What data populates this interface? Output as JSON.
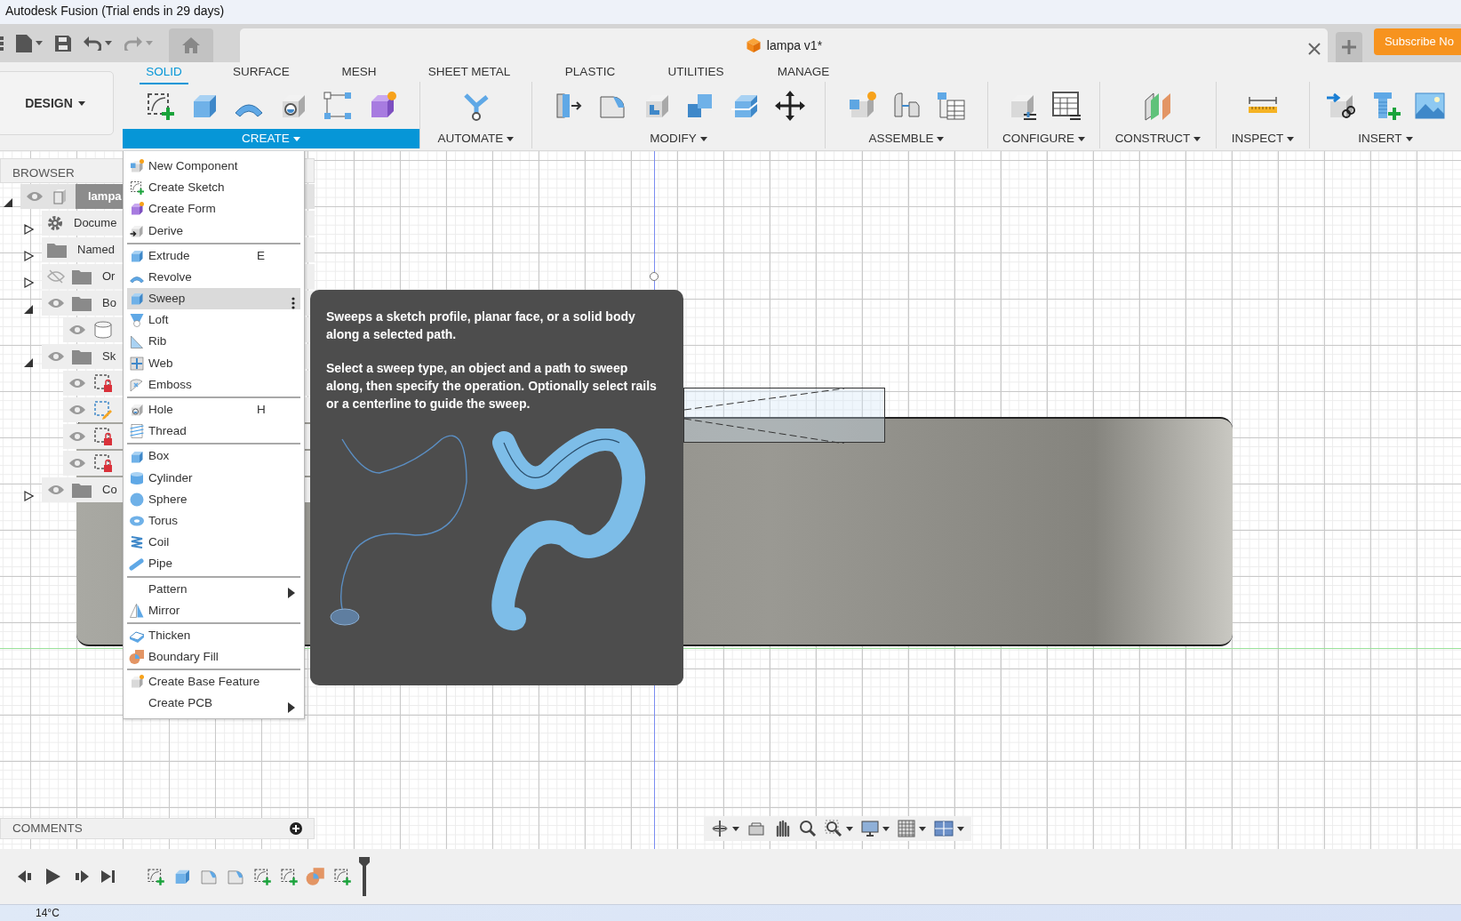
{
  "window": {
    "title": "Autodesk Fusion (Trial ends in 29 days)"
  },
  "document_tab": {
    "title": "lampa v1*"
  },
  "subscribe_button": {
    "label": "Subscribe No"
  },
  "workspace_menu": {
    "label": "DESIGN"
  },
  "ribbon_tabs": [
    {
      "label": "SOLID",
      "selected": true
    },
    {
      "label": "SURFACE",
      "selected": false
    },
    {
      "label": "MESH",
      "selected": false
    },
    {
      "label": "SHEET METAL",
      "selected": false
    },
    {
      "label": "PLASTIC",
      "selected": false
    },
    {
      "label": "UTILITIES",
      "selected": false
    },
    {
      "label": "MANAGE",
      "selected": false
    }
  ],
  "tool_groups": [
    {
      "label": "CREATE",
      "selected": true
    },
    {
      "label": "AUTOMATE",
      "selected": false
    },
    {
      "label": "MODIFY",
      "selected": false
    },
    {
      "label": "ASSEMBLE",
      "selected": false
    },
    {
      "label": "CONFIGURE",
      "selected": false
    },
    {
      "label": "CONSTRUCT",
      "selected": false
    },
    {
      "label": "INSPECT",
      "selected": false
    },
    {
      "label": "INSERT",
      "selected": false
    }
  ],
  "browser": {
    "title": "BROWSER",
    "items": [
      {
        "label": "lampa",
        "kind": "component",
        "visible": true,
        "expanded": true,
        "selected": true,
        "children": [
          {
            "label": "Docume",
            "kind": "settings",
            "expanded": false,
            "selected": false
          },
          {
            "label": "Named",
            "kind": "folder",
            "expanded": false,
            "selected": false
          },
          {
            "label": "Or",
            "kind": "folder",
            "visible": false,
            "expanded": false,
            "selected": false
          },
          {
            "label": "Bo",
            "kind": "folder",
            "visible": true,
            "expanded": true,
            "selected": false,
            "children": [
              {
                "kind": "body",
                "visible": true,
                "selected": false
              }
            ]
          },
          {
            "label": "Sk",
            "kind": "folder",
            "visible": true,
            "expanded": true,
            "selected": false,
            "children": [
              {
                "kind": "sketch",
                "visible": true,
                "locked": true,
                "selected": false
              },
              {
                "kind": "sketch",
                "visible": true,
                "locked": false,
                "selected": false
              },
              {
                "kind": "sketch",
                "visible": true,
                "locked": true,
                "selected": false
              },
              {
                "kind": "sketch",
                "visible": true,
                "locked": true,
                "selected": false
              }
            ]
          },
          {
            "label": "Co",
            "kind": "folder",
            "visible": true,
            "expanded": false,
            "selected": false
          }
        ]
      }
    ]
  },
  "create_menu": {
    "sections": [
      [
        {
          "label": "New Component",
          "selected": false
        },
        {
          "label": "Create Sketch",
          "selected": false
        },
        {
          "label": "Create Form",
          "selected": false
        },
        {
          "label": "Derive",
          "selected": false
        }
      ],
      [
        {
          "label": "Extrude",
          "shortcut": "E",
          "selected": false
        },
        {
          "label": "Revolve",
          "selected": false
        },
        {
          "label": "Sweep",
          "selected": true
        },
        {
          "label": "Loft",
          "selected": false
        },
        {
          "label": "Rib",
          "selected": false
        },
        {
          "label": "Web",
          "selected": false
        },
        {
          "label": "Emboss",
          "selected": false
        }
      ],
      [
        {
          "label": "Hole",
          "shortcut": "H",
          "selected": false
        },
        {
          "label": "Thread",
          "selected": false
        }
      ],
      [
        {
          "label": "Box",
          "selected": false
        },
        {
          "label": "Cylinder",
          "selected": false
        },
        {
          "label": "Sphere",
          "selected": false
        },
        {
          "label": "Torus",
          "selected": false
        },
        {
          "label": "Coil",
          "selected": false
        },
        {
          "label": "Pipe",
          "selected": false
        }
      ],
      [
        {
          "label": "Pattern",
          "submenu": true,
          "selected": false
        },
        {
          "label": "Mirror",
          "selected": false
        }
      ],
      [
        {
          "label": "Thicken",
          "selected": false
        },
        {
          "label": "Boundary Fill",
          "selected": false
        }
      ],
      [
        {
          "label": "Create Base Feature",
          "selected": false
        },
        {
          "label": "Create PCB",
          "submenu": true,
          "selected": false
        }
      ]
    ]
  },
  "tooltip": {
    "paragraphs": [
      "Sweeps a sketch profile, planar face, or a solid body along a selected path.",
      "Select a sweep type, an object and a path to sweep along, then specify the operation. Optionally select rails or a centerline to guide the sweep."
    ]
  },
  "comments_panel": {
    "title": "COMMENTS"
  },
  "taskbar": {
    "weather": "14°C"
  }
}
